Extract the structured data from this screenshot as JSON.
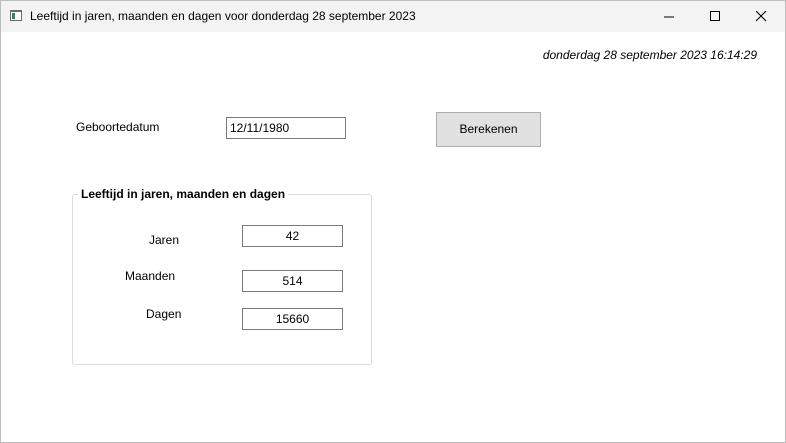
{
  "window": {
    "title": "Leeftijd in jaren, maanden en dagen voor donderdag 28 september 2023"
  },
  "header": {
    "datetime": "donderdag 28 september 2023  16:14:29"
  },
  "form": {
    "birthdate_label": "Geboortedatum",
    "birthdate_value": "12/11/1980",
    "calculate_button": "Berekenen"
  },
  "result": {
    "group_title": "Leeftijd in jaren, maanden en dagen",
    "years_label": "Jaren",
    "years_value": "42",
    "months_label": "Maanden",
    "months_value": "514",
    "days_label": "Dagen",
    "days_value": "15660"
  },
  "icons": {
    "app": "app-window-icon",
    "minimize": "minimize-icon",
    "maximize": "maximize-icon",
    "close": "close-icon"
  }
}
